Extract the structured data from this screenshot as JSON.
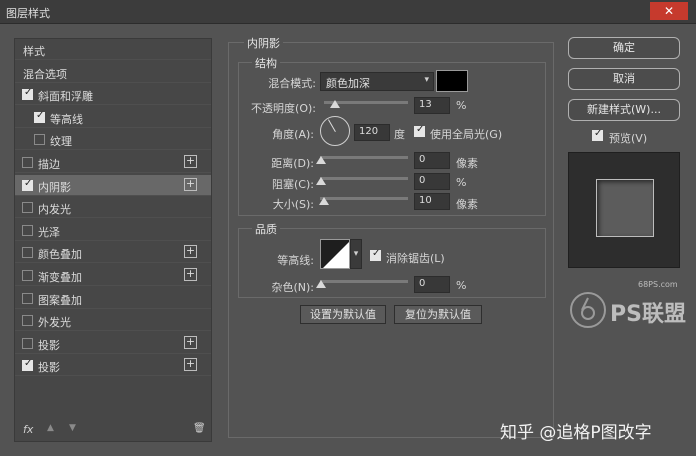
{
  "window": {
    "title": "图层样式",
    "close_label": "✕"
  },
  "left_panel": {
    "items": [
      {
        "label": "样式",
        "checkbox": false,
        "plus": false,
        "sel": false
      },
      {
        "label": "混合选项",
        "checkbox": false,
        "plus": false,
        "sel": false
      },
      {
        "label": "斜面和浮雕",
        "checkbox": true,
        "checked": true,
        "plus": false,
        "sel": false
      },
      {
        "label": "等高线",
        "checkbox": true,
        "checked": true,
        "plus": false,
        "sel": false,
        "indent": true
      },
      {
        "label": "纹理",
        "checkbox": true,
        "checked": false,
        "plus": false,
        "sel": false,
        "indent": true
      },
      {
        "label": "描边",
        "checkbox": true,
        "checked": false,
        "plus": true,
        "sel": false
      },
      {
        "label": "内阴影",
        "checkbox": true,
        "checked": true,
        "plus": true,
        "sel": true
      },
      {
        "label": "内发光",
        "checkbox": true,
        "checked": false,
        "plus": false,
        "sel": false
      },
      {
        "label": "光泽",
        "checkbox": true,
        "checked": false,
        "plus": false,
        "sel": false
      },
      {
        "label": "颜色叠加",
        "checkbox": true,
        "checked": false,
        "plus": true,
        "sel": false
      },
      {
        "label": "渐变叠加",
        "checkbox": true,
        "checked": false,
        "plus": true,
        "sel": false
      },
      {
        "label": "图案叠加",
        "checkbox": true,
        "checked": false,
        "plus": false,
        "sel": false
      },
      {
        "label": "外发光",
        "checkbox": true,
        "checked": false,
        "plus": false,
        "sel": false
      },
      {
        "label": "投影",
        "checkbox": true,
        "checked": false,
        "plus": true,
        "sel": false
      },
      {
        "label": "投影",
        "checkbox": true,
        "checked": true,
        "plus": true,
        "sel": false
      }
    ],
    "footer": {
      "fx_label": "fx",
      "up_icon": "▲",
      "down_icon": "▼",
      "trash_icon": "🗑"
    }
  },
  "inner_shadow": {
    "section_title": "内阴影",
    "structure_title": "结构",
    "blend_mode_label": "混合模式:",
    "blend_mode_value": "颜色加深",
    "shadow_color": "#000000",
    "opacity_label": "不透明度(O):",
    "opacity_value": "13",
    "opacity_unit": "%",
    "opacity_level": 0.13,
    "angle_label": "角度(A):",
    "angle_value": "120",
    "angle_unit": "度",
    "global_light_label": "使用全局光(G)",
    "global_light_checked": true,
    "distance_label": "距离(D):",
    "distance_value": "0",
    "distance_unit": "像素",
    "choke_label": "阻塞(C):",
    "choke_value": "0",
    "choke_unit": "%",
    "size_label": "大小(S):",
    "size_value": "10",
    "size_unit": "像素",
    "size_level": 0.04,
    "quality_title": "品质",
    "contour_label": "等高线:",
    "antialias_label": "消除锯齿(L)",
    "antialias_checked": true,
    "noise_label": "杂色(N):",
    "noise_value": "0",
    "noise_unit": "%",
    "set_default_label": "设置为默认值",
    "reset_default_label": "复位为默认值"
  },
  "right_panel": {
    "ok_label": "确定",
    "cancel_label": "取消",
    "new_style_label": "新建样式(W)...",
    "preview_label": "预览(V)",
    "preview_checked": true
  },
  "watermarks": {
    "site": "68PS.com",
    "logo_text": "PS联盟",
    "zhihu": "知乎 @追格P图改字"
  }
}
